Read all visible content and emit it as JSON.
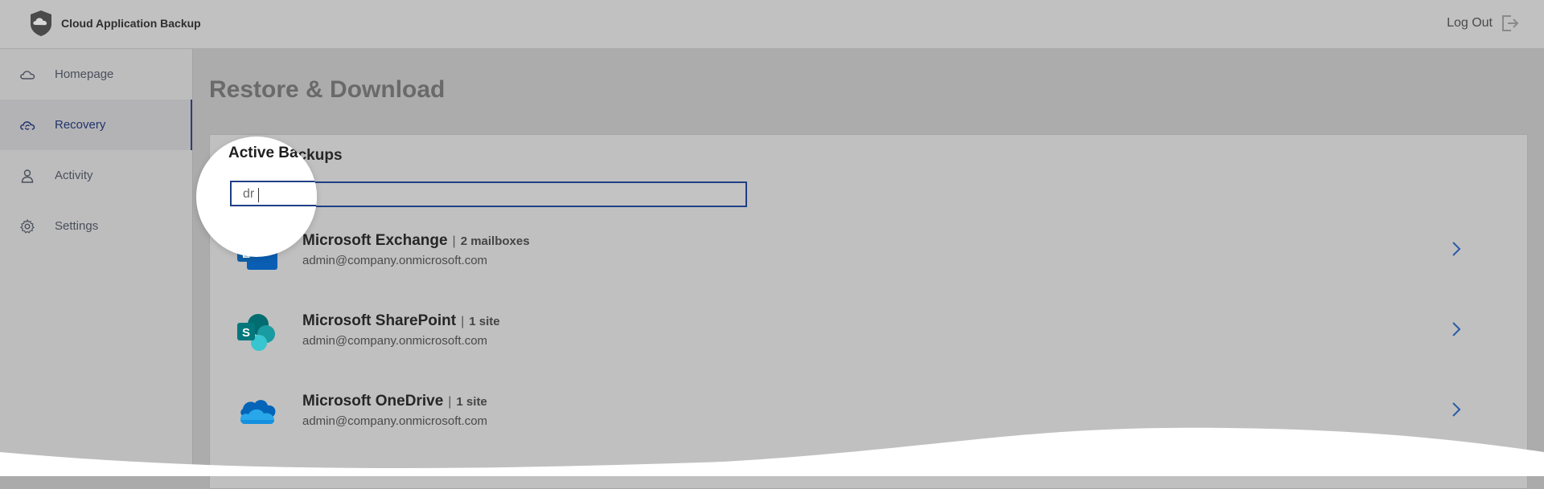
{
  "header": {
    "app_title": "Cloud Application Backup",
    "logout_label": "Log Out"
  },
  "sidebar": {
    "items": [
      {
        "label": "Homepage",
        "icon": "cloud-icon",
        "active": false
      },
      {
        "label": "Recovery",
        "icon": "cloud-sync-icon",
        "active": true
      },
      {
        "label": "Activity",
        "icon": "user-icon",
        "active": false
      },
      {
        "label": "Settings",
        "icon": "gear-icon",
        "active": false
      }
    ]
  },
  "main": {
    "page_title": "Restore & Download",
    "panel_title": "Active Backups",
    "magnified_title": "Active Ba",
    "search_value": "dr",
    "backups": [
      {
        "name": "Microsoft Exchange",
        "count": "2 mailboxes",
        "account": "admin@company.onmicrosoft.com",
        "icon": "exchange-icon"
      },
      {
        "name": "Microsoft SharePoint",
        "count": "1 site",
        "account": "admin@company.onmicrosoft.com",
        "icon": "sharepoint-icon"
      },
      {
        "name": "Microsoft OneDrive",
        "count": "1 site",
        "account": "admin@company.onmicrosoft.com",
        "icon": "onedrive-icon"
      }
    ]
  },
  "colors": {
    "accent": "#1f3f86",
    "active_nav": "#22336b",
    "chevron": "#2a5aa8"
  }
}
